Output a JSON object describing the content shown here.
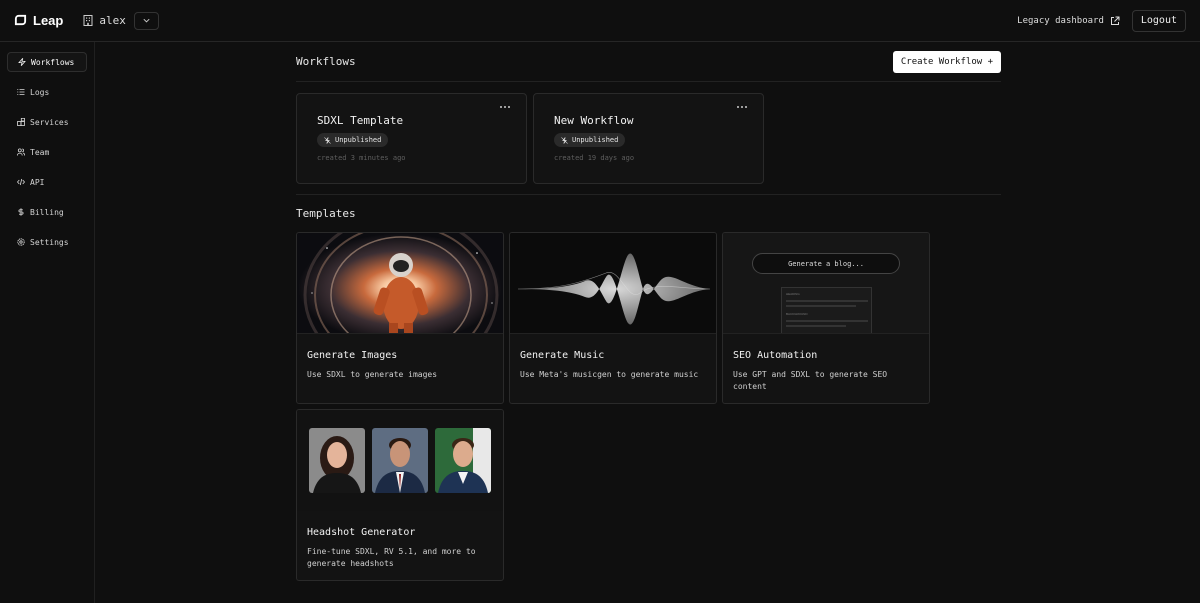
{
  "topbar": {
    "brand": "Leap",
    "org_name": "alex",
    "legacy_link": "Legacy dashboard",
    "logout_label": "Logout"
  },
  "sidebar": {
    "items": [
      {
        "label": "Workflows",
        "icon": "bolt-icon"
      },
      {
        "label": "Logs",
        "icon": "list-icon"
      },
      {
        "label": "Services",
        "icon": "services-icon"
      },
      {
        "label": "Team",
        "icon": "users-icon"
      },
      {
        "label": "API",
        "icon": "code-icon"
      },
      {
        "label": "Billing",
        "icon": "dollar-icon"
      },
      {
        "label": "Settings",
        "icon": "gear-icon"
      }
    ]
  },
  "main": {
    "workflows_title": "Workflows",
    "create_label": "Create Workflow +",
    "workflows": [
      {
        "title": "SDXL Template",
        "status": "Unpublished",
        "created": "created 3 minutes ago"
      },
      {
        "title": "New Workflow",
        "status": "Unpublished",
        "created": "created 19 days ago"
      }
    ],
    "templates_title": "Templates",
    "templates": [
      {
        "title": "Generate Images",
        "desc": "Use SDXL to generate images"
      },
      {
        "title": "Generate Music",
        "desc": "Use Meta's musicgen to generate music"
      },
      {
        "title": "SEO Automation",
        "desc": "Use GPT and SDXL to generate SEO content"
      },
      {
        "title": "Headshot Generator",
        "desc": "Fine-tune SDXL, RV 5.1, and more to generate headshots"
      }
    ],
    "seo_preview": {
      "prompt": "Generate a blog...",
      "heading_label": "HEADING",
      "background_label": "BACKGROUND"
    }
  }
}
